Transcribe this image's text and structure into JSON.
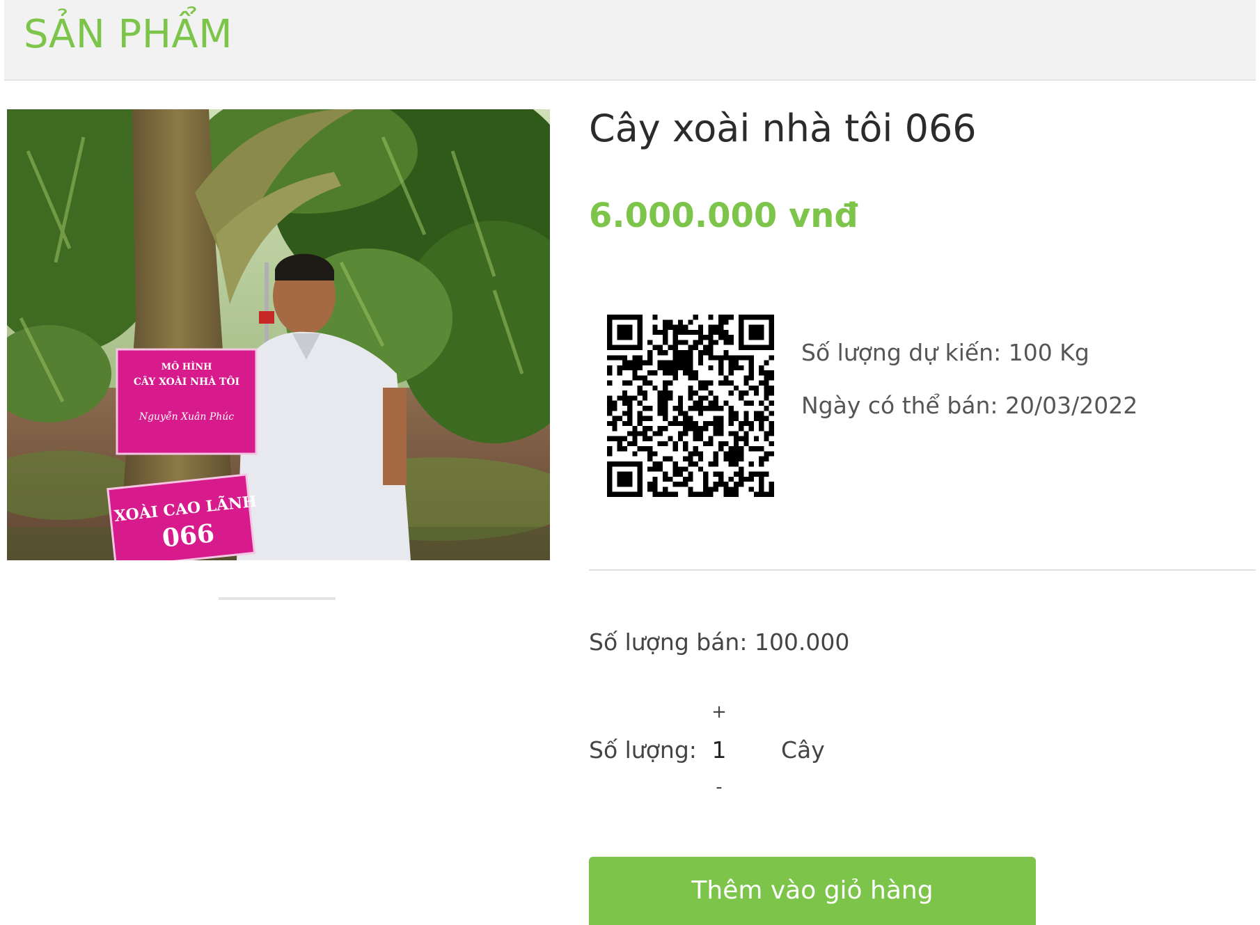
{
  "header": {
    "title": "SẢN PHẨM"
  },
  "product": {
    "name": "Cây xoài nhà tôi 066",
    "price": "6.000.000 vnđ",
    "expected_quantity": "Số lượng dự kiến: 100 Kg",
    "sale_date": "Ngày có thể bán: 20/03/2022",
    "sold_quantity": "Số lượng bán: 100.000"
  },
  "photo": {
    "sign_top_lines": [
      "MÔ HÌNH",
      "CÂY XOÀI NHÀ TÔI",
      "Nguyễn Xuân Phúc"
    ],
    "sign_bottom_lines": [
      "XOÀI CAO LÃNH",
      "066"
    ]
  },
  "quantity": {
    "label": "Số lượng:",
    "plus": "+",
    "value": "1",
    "minus": "-",
    "unit": "Cây"
  },
  "actions": {
    "add_to_cart": "Thêm vào giỏ hàng"
  },
  "colors": {
    "accent": "#7cc54a",
    "header_bg": "#f2f2f2",
    "sign_pink": "#d81b8c"
  },
  "icons": {
    "qr_code": "qr-code-icon"
  }
}
